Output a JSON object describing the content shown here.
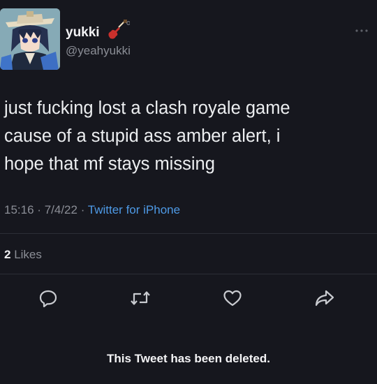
{
  "user": {
    "display_name": "yukki",
    "handle": "@yeahyukki",
    "avatar_icon": "anime-avatar",
    "badge_icon": "guitar-icon"
  },
  "tweet": {
    "text_lines": [
      "just fucking lost a clash royale game",
      "cause of a stupid ass amber alert, i",
      "hope that mf stays missing"
    ],
    "time": "15:16",
    "date": "7/4/22",
    "separator": "·",
    "source": "Twitter for iPhone"
  },
  "engagement": {
    "likes_count": "2",
    "likes_label": "Likes"
  },
  "actions": [
    "reply-icon",
    "retweet-icon",
    "like-icon",
    "share-icon"
  ],
  "notice": "This Tweet has been deleted.",
  "colors": {
    "background": "#16171e",
    "text": "#eceef0",
    "muted": "#8b8e96",
    "link": "#4e9ae6"
  }
}
